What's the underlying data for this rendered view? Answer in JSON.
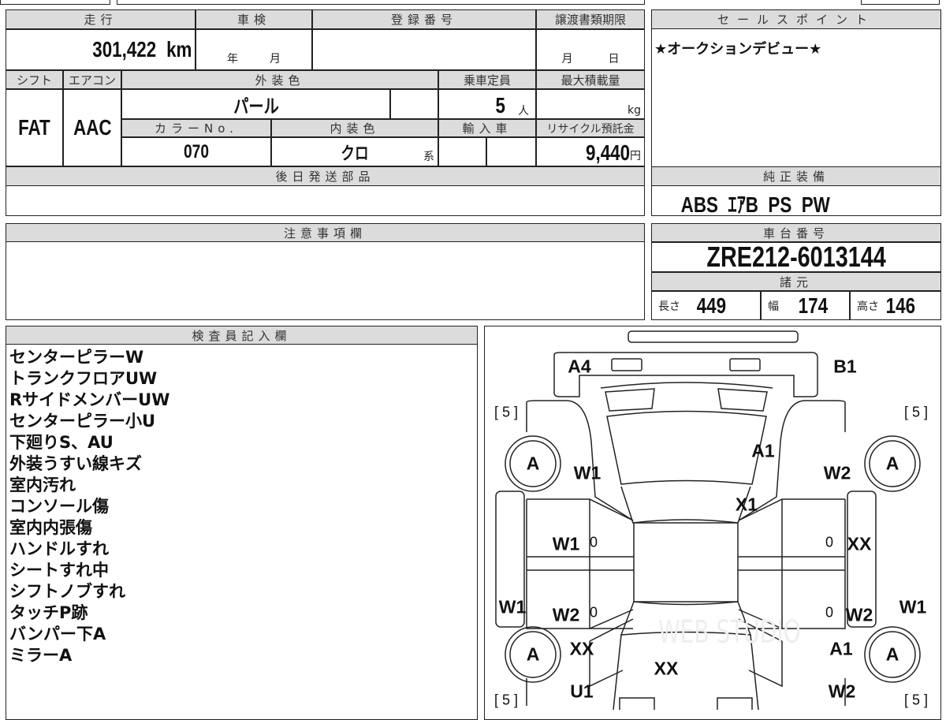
{
  "top_form": {
    "headers": {
      "mileage": "走行",
      "inspection": "車検",
      "registration": "登録番号",
      "transfer_deadline": "譲渡書類期限",
      "shift": "シフト",
      "aircon": "エアコン",
      "exterior_color": "外装色",
      "capacity": "乗車定員",
      "max_load": "最大積載量",
      "color_no": "カラーNo.",
      "interior_color": "内装色",
      "import": "輸入車",
      "recycle_fee": "リサイクル預託金",
      "later_parts": "後日発送部品"
    },
    "mileage": "301,422",
    "mileage_unit": "km",
    "inspection_year_unit": "年",
    "inspection_month_unit": "月",
    "transfer_month_unit": "月",
    "transfer_day_unit": "日",
    "shift": "FAT",
    "aircon": "AAC",
    "exterior_color": "パール",
    "capacity": "5",
    "capacity_unit": "人",
    "max_load_unit": "kg",
    "color_no": "070",
    "interior_color": "クロ",
    "interior_suffix": "系",
    "recycle_fee": "9,440",
    "recycle_unit": "円"
  },
  "sales_point": {
    "header": "セールスポイント",
    "text": "★オークションデビュー★"
  },
  "equipment": {
    "header": "純正装備",
    "text": "ABS  ｴｱB  PS  PW"
  },
  "caution": {
    "header": "注意事項欄"
  },
  "chassis": {
    "header": "車台番号",
    "value": "ZRE212-6013144",
    "spec_header": "諸元",
    "length_label": "長さ",
    "length": "449",
    "width_label": "幅",
    "width": "174",
    "height_label": "高さ",
    "height": "146"
  },
  "inspector": {
    "header": "検査員記入欄",
    "notes": [
      "センターピラーW",
      "トランクフロアUW",
      "RサイドメンバーUW",
      "センターピラー小U",
      "下廻りS、AU",
      "外装うすい線キズ",
      "室内汚れ",
      "コンソール傷",
      "室内内張傷",
      "ハンドルすれ",
      "シートすれ中",
      "シフトノブすれ",
      "タッチP跡",
      "バンパー下A",
      "ミラーA"
    ]
  },
  "diagram": {
    "marks": [
      "A4",
      "B1",
      "[ 5 ]",
      "[ 5 ]",
      "[ 5 ]",
      "[ 5 ]",
      "A",
      "A",
      "A",
      "A",
      "W1",
      "A1",
      "W2",
      "X1",
      "W1",
      "0",
      "0",
      "XX",
      "W1",
      "W2",
      "0",
      "0",
      "W2",
      "W1",
      "XX",
      "A1",
      "XX",
      "U1",
      "W2"
    ]
  }
}
